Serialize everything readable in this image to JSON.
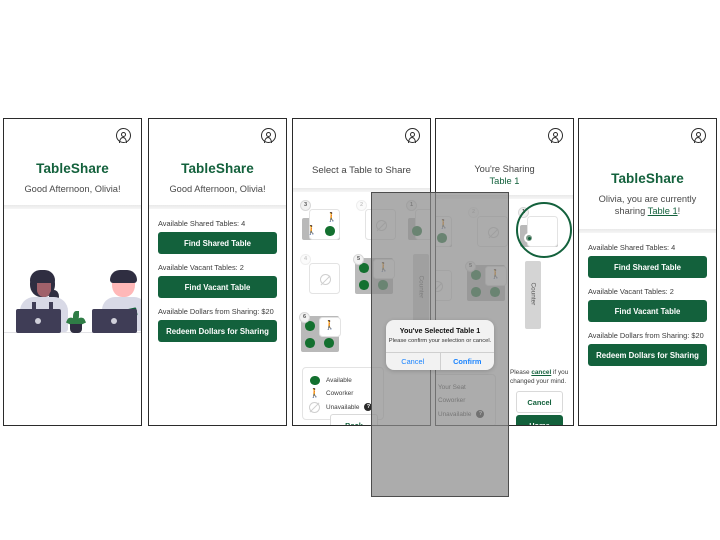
{
  "app": {
    "brand": "TableShare",
    "accent_green": "#13613c",
    "seat_green": "#13702f",
    "link_blue": "#1a84ff"
  },
  "screens": [
    {
      "id": "home-illustration",
      "brand": "TableShare",
      "greeting": "Good Afternoon, Olivia!",
      "avatar_icon": "account-circle-icon"
    },
    {
      "id": "home-actions",
      "brand": "TableShare",
      "greeting": "Good Afternoon, Olivia!",
      "stats": [
        {
          "label": "Available Shared Tables: 4",
          "button": "Find Shared Table"
        },
        {
          "label": "Available Vacant Tables: 2",
          "button": "Find Vacant Table"
        },
        {
          "label": "Available Dollars from Sharing: $20",
          "button": "Redeem Dollars for Sharing"
        }
      ]
    },
    {
      "id": "select-table",
      "title": "Select a Table to Share",
      "counter_label": "Counter",
      "legend": [
        {
          "icon": "green-dot-icon",
          "label": "Available"
        },
        {
          "icon": "coworker-icon",
          "label": "Coworker"
        },
        {
          "icon": "unavailable-icon",
          "label": "Unavailable",
          "help": "?"
        }
      ],
      "back_button": "Back",
      "tables": [
        {
          "number": "3",
          "state": "open"
        },
        {
          "number": "2",
          "state": "unavailable"
        },
        {
          "number": "1",
          "state": "open"
        },
        {
          "number": "4",
          "state": "unavailable"
        },
        {
          "number": "5",
          "state": "open"
        },
        {
          "number": "6",
          "state": "open"
        }
      ]
    },
    {
      "id": "sharing-confirmed",
      "title_line1": "You're Sharing",
      "title_line2": "Table 1",
      "counter_label": "Counter",
      "note_prefix": "Please ",
      "note_link": "cancel",
      "note_suffix": " if you changed your mind.",
      "cancel_button": "Cancel",
      "home_button": "Home",
      "legend_unavailable": "Unavailable",
      "legend_your_seat": "Your Seat"
    },
    {
      "id": "home-sharing",
      "brand": "TableShare",
      "greeting_pre": "Olivia, you are currently sharing ",
      "greeting_table": "Table 1",
      "greeting_post": "!",
      "stats": [
        {
          "label": "Available Shared Tables: 4",
          "button": "Find Shared Table"
        },
        {
          "label": "Available Vacant Tables: 2",
          "button": "Find Vacant Table"
        },
        {
          "label": "Available Dollars from Sharing: $20",
          "button": "Redeem Dollars for Sharing"
        }
      ]
    }
  ],
  "modal": {
    "title": "You've Selected Table 1",
    "subtitle": "Please confirm your selection or cancel.",
    "cancel": "Cancel",
    "confirm": "Confirm"
  }
}
